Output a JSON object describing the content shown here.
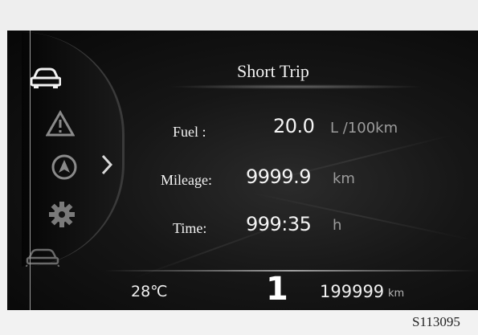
{
  "display": {
    "title": "Short Trip",
    "rows": [
      {
        "label": "Fuel :",
        "value": "20.0",
        "unit": "L /100km"
      },
      {
        "label": "Mileage:",
        "value": "9999.9",
        "unit": "km"
      },
      {
        "label": "Time:",
        "value": "999:35",
        "unit": "h"
      }
    ],
    "menu_icons": [
      "car-icon",
      "warning-icon",
      "navigation-icon",
      "settings-gear-icon",
      "driver-assist-icon"
    ]
  },
  "status_bar": {
    "temperature": "28℃",
    "gear": "1",
    "odometer": "199999",
    "odometer_unit": "km"
  },
  "figure_code": "S113095"
}
